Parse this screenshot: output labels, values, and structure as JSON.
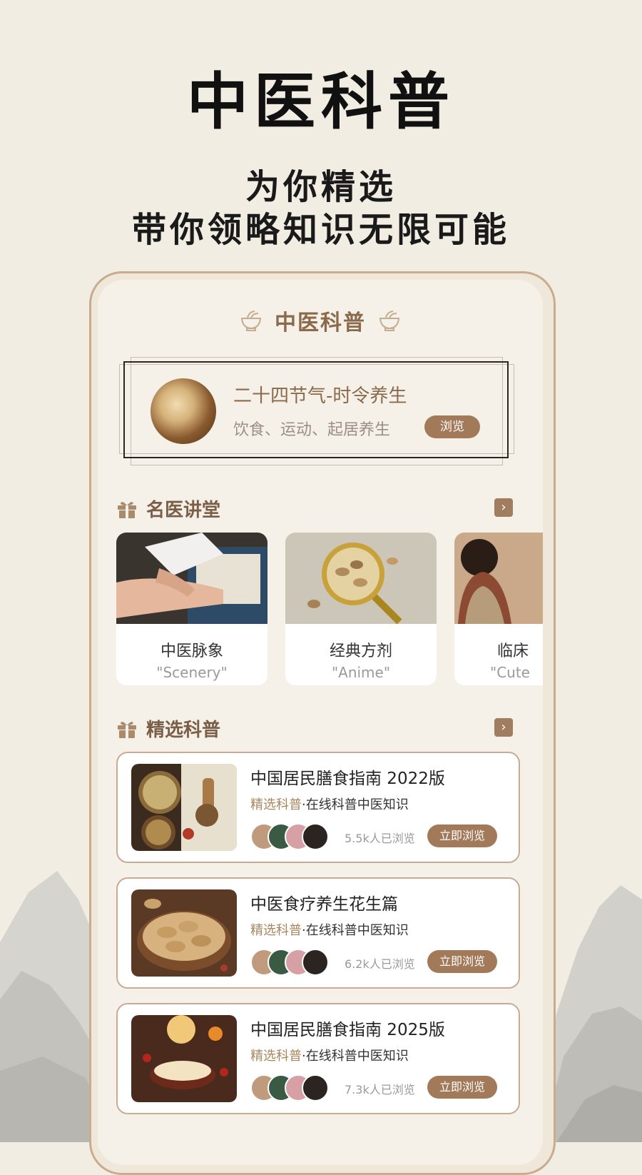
{
  "hero": {
    "title": "中医科普",
    "subtitle_line1": "为你精选",
    "subtitle_line2": "带你领略知识无限可能"
  },
  "app": {
    "header_title": "中医科普",
    "featured": {
      "title": "二十四节气-时令养生",
      "subtitle": "饮食、运动、起居养生",
      "button": "浏览"
    },
    "lectures": {
      "section_title": "名医讲堂",
      "items": [
        {
          "title": "中医脉象",
          "subtitle": "\"Scenery\""
        },
        {
          "title": "经典方剂",
          "subtitle": "\"Anime\""
        },
        {
          "title": "临床",
          "subtitle": "\"Cute"
        }
      ]
    },
    "articles": {
      "section_title": "精选科普",
      "items": [
        {
          "title": "中国居民膳食指南 2022版",
          "tag": "精选科普",
          "desc": "·在线科普中医知识",
          "views": "5.5k人已浏览",
          "button": "立即浏览"
        },
        {
          "title": "中医食疗养生花生篇",
          "tag": "精选科普",
          "desc": "·在线科普中医知识",
          "views": "6.2k人已浏览",
          "button": "立即浏览"
        },
        {
          "title": "中国居民膳食指南 2025版",
          "tag": "精选科普",
          "desc": "·在线科普中医知识",
          "views": "7.3k人已浏览",
          "button": "立即浏览"
        }
      ]
    }
  },
  "colors": {
    "background": "#f2ede3",
    "accent_brown": "#a27a5a",
    "title_brown": "#8b6a4c",
    "card_border": "#c8ab92"
  },
  "icons": {
    "header": "mortar-bowl-icon",
    "section": "gift-box-icon",
    "more": "chevron-right-icon"
  }
}
